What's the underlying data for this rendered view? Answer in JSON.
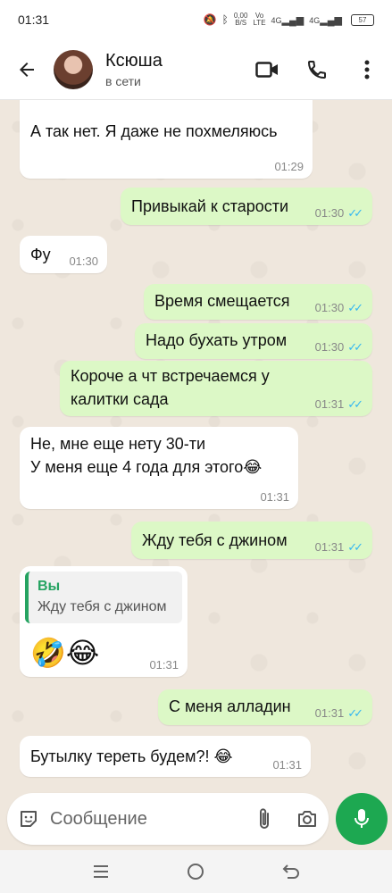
{
  "status_bar": {
    "time": "01:31",
    "net_speed": "0,00\nB/S",
    "net_top": "0,00",
    "net_bottom": "B/S",
    "vo_top": "Vo",
    "vo_bottom": "LTE",
    "sig1": "4G",
    "sig2": "4G",
    "battery": "57"
  },
  "header": {
    "contact_name": "Ксюша",
    "contact_status": "в сети"
  },
  "messages": [
    {
      "dir": "in",
      "text": "А так нет. Я даже не похмеляюсь",
      "time": "01:29"
    },
    {
      "dir": "out",
      "text": "Привыкай к старости",
      "time": "01:30"
    },
    {
      "dir": "in",
      "text": "Фу",
      "time": "01:30"
    },
    {
      "dir": "out",
      "text": "Время смещается",
      "time": "01:30"
    },
    {
      "dir": "out",
      "text": "Надо бухать утром",
      "time": "01:30"
    },
    {
      "dir": "out",
      "line1": "Короче а чт встречаемся у",
      "line2": "калитки сада",
      "time": "01:31"
    },
    {
      "dir": "in",
      "line1": "Не, мне еще нету 30-ти",
      "line2": "У меня еще 4 года для этого😂",
      "time": "01:31"
    },
    {
      "dir": "out",
      "text": "Жду тебя с джином",
      "time": "01:31"
    },
    {
      "dir": "in",
      "quote_name": "Вы",
      "quote_text": "Жду тебя с джином",
      "text": "🤣😂",
      "time": "01:31"
    },
    {
      "dir": "out",
      "text": "С меня алладин",
      "time": "01:31"
    },
    {
      "dir": "in",
      "text": "Бутылку тереть будем?! 😂",
      "time": "01:31"
    }
  ],
  "composer": {
    "placeholder": "Сообщение"
  },
  "colors": {
    "incoming_bubble": "#ffffff",
    "outgoing_bubble": "#dcf8c6",
    "read_ticks": "#34b7f1",
    "accent_green": "#1da851",
    "chat_background": "#efe7dd"
  }
}
